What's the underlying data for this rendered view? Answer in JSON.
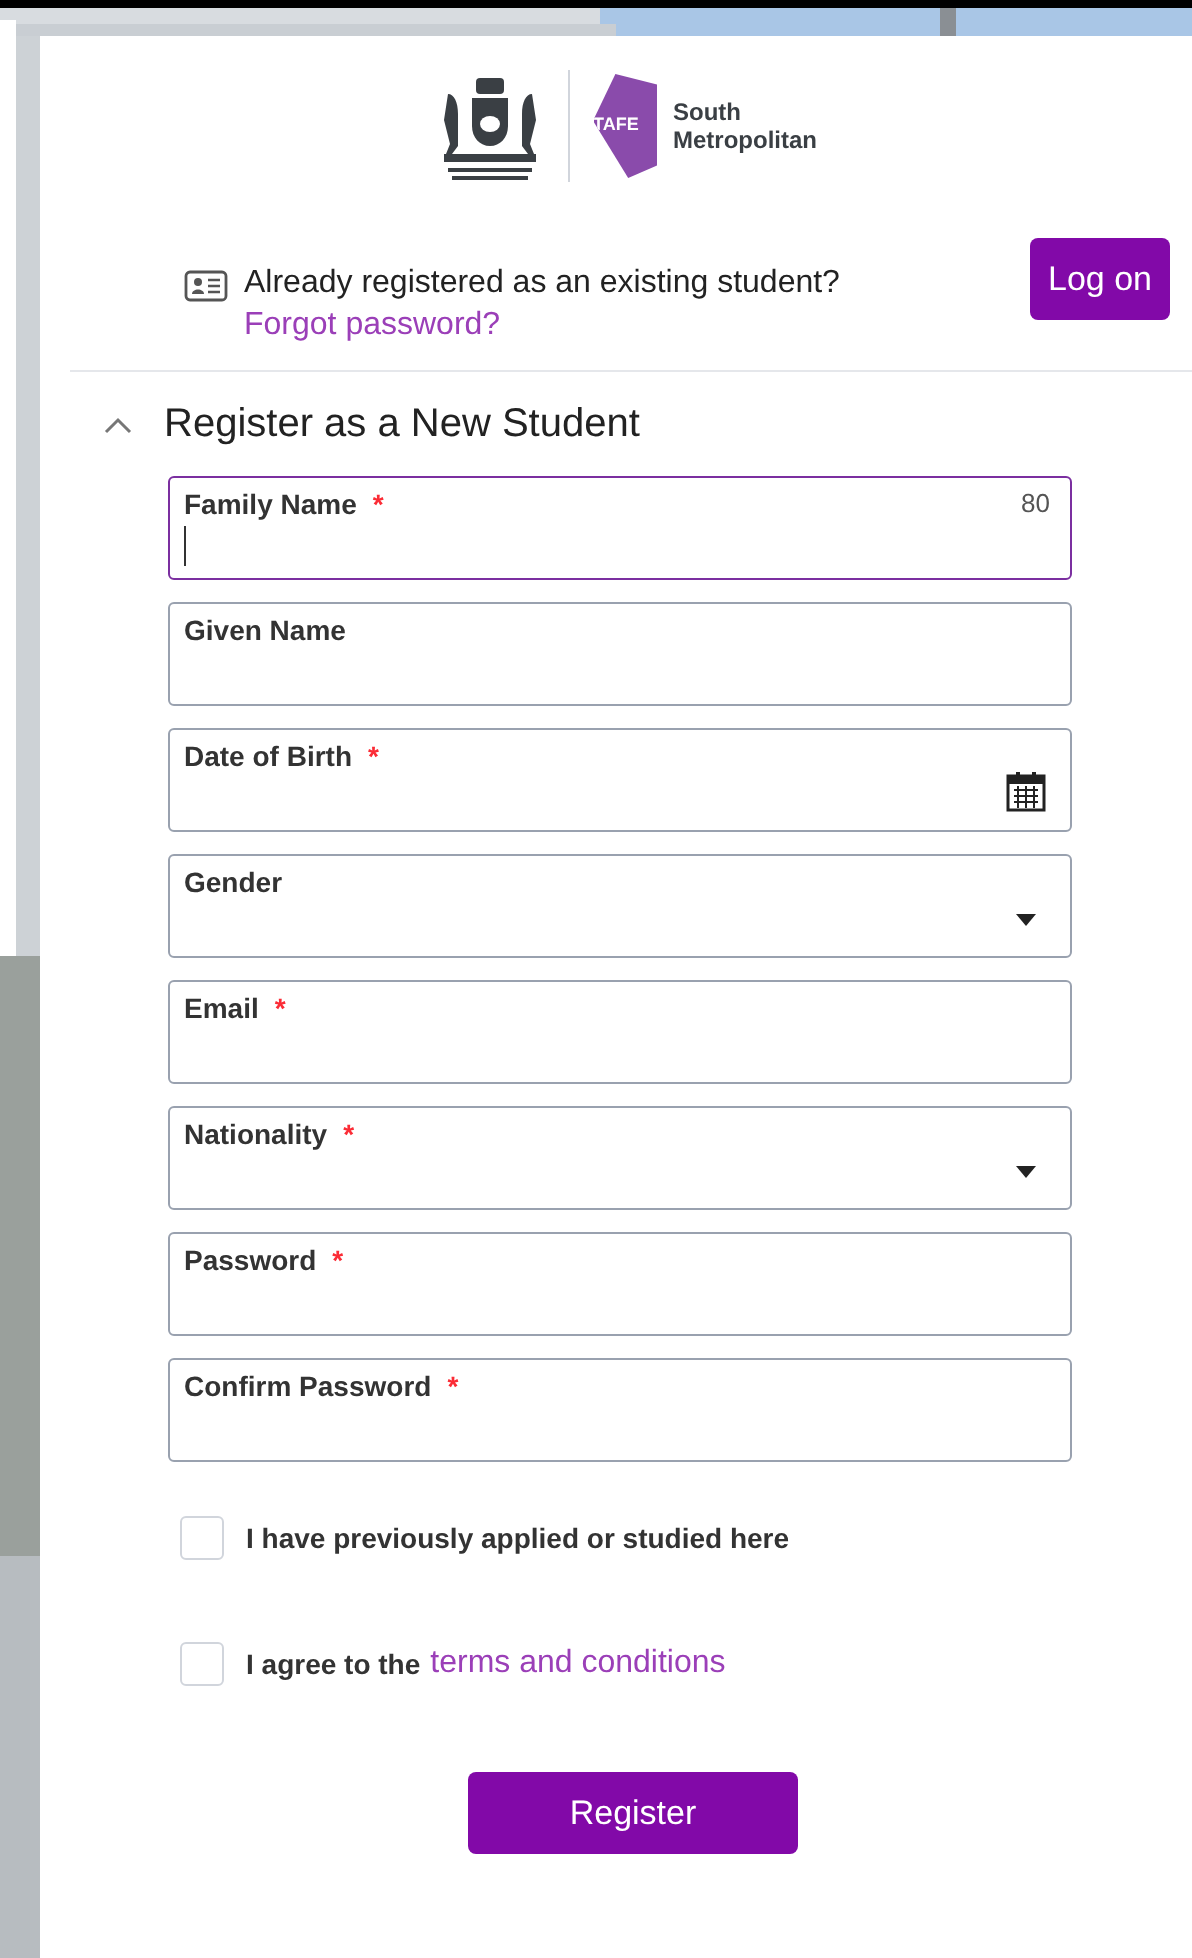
{
  "logo": {
    "brand_mark": "TAFE",
    "name_lines": [
      "South",
      "Metropolitan"
    ]
  },
  "login_prompt": {
    "text": "Already registered as an existing student?",
    "link": "Forgot password?",
    "button": "Log on"
  },
  "section": {
    "title": "Register as a New Student",
    "expanded": true
  },
  "fields": [
    {
      "label": "Family Name",
      "required": true,
      "kind": "text",
      "focused": true,
      "counter": "80"
    },
    {
      "label": "Given Name",
      "required": false,
      "kind": "text",
      "focused": false
    },
    {
      "label": "Date of Birth",
      "required": true,
      "kind": "date",
      "focused": false
    },
    {
      "label": "Gender",
      "required": false,
      "kind": "select",
      "focused": false
    },
    {
      "label": "Email",
      "required": true,
      "kind": "text",
      "focused": false
    },
    {
      "label": "Nationality",
      "required": true,
      "kind": "select",
      "focused": false
    },
    {
      "label": "Password",
      "required": true,
      "kind": "text",
      "focused": false
    },
    {
      "label": "Confirm Password",
      "required": true,
      "kind": "text",
      "focused": false
    }
  ],
  "checkboxes": [
    {
      "text": "I have previously applied or studied here",
      "checked": false
    },
    {
      "text": "I agree to the",
      "link": "terms and conditions",
      "checked": false
    }
  ],
  "submit_button": "Register",
  "required_mark": "*"
}
